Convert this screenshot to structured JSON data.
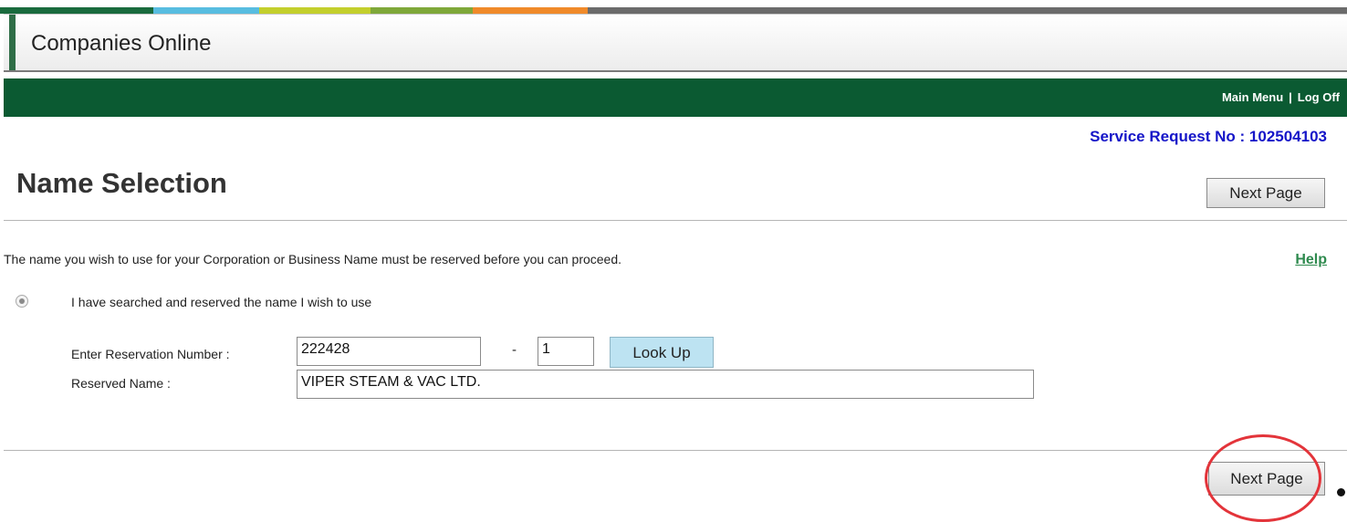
{
  "header": {
    "title": "Companies Online",
    "stripe_colors": [
      "#1a6b3e",
      "#58bde0",
      "#c3cf2d",
      "#7fa83a",
      "#f08a2a",
      "#6b6b6b"
    ]
  },
  "nav": {
    "main_menu": "Main Menu",
    "separator": "|",
    "log_off": "Log Off"
  },
  "service_request": "Service Request No : 102504103",
  "page": {
    "title": "Name Selection",
    "next_page_top": "Next Page",
    "intro": "The name you wish to use for your Corporation or Business Name must be reserved before you can proceed.",
    "help": "Help"
  },
  "option": {
    "label": "I have searched and reserved the name I wish to use"
  },
  "reservation": {
    "number_label": "Enter Reservation Number :",
    "number_value": "222428",
    "dash": "-",
    "suffix_value": "1",
    "lookup_label": "Look Up",
    "name_label": "Reserved Name :",
    "name_value": "VIPER STEAM & VAC LTD."
  },
  "footer": {
    "next_page_bottom": "Next Page"
  },
  "colors": {
    "green_bar": "#0b5a32",
    "service_text": "#1515c8",
    "help_link": "#2e8a4e",
    "lookup_bg": "#bde3f2",
    "highlight_circle": "#e3343a"
  }
}
